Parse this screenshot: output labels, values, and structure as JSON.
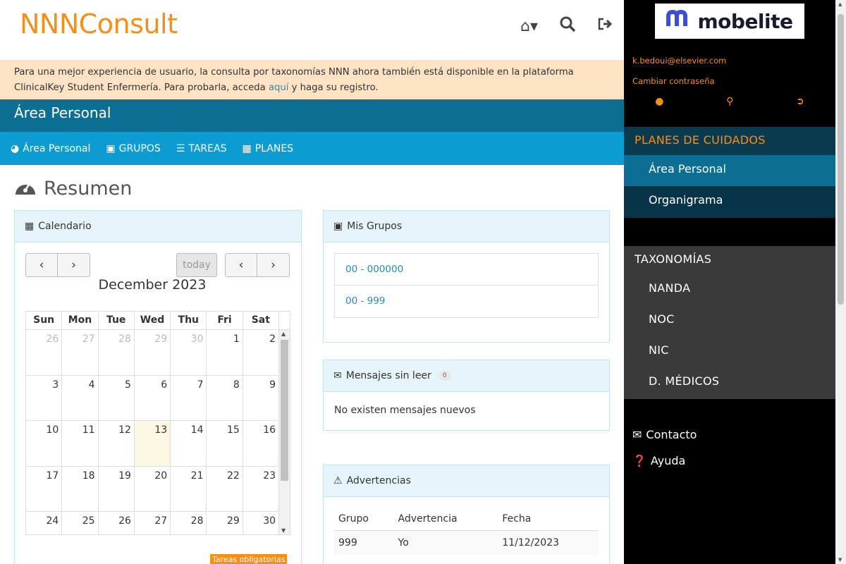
{
  "app": {
    "logo": "NNNConsult"
  },
  "banner": {
    "text_before": "Para una mejor experiencia de usuario, la consulta por taxonomías NNN ahora también está disponible en la plataforma ClinicalKey Student Enfermería. Para probarla, acceda ",
    "link": "aquí",
    "text_after": " y haga su registro."
  },
  "area_header": "Área Personal",
  "nav": [
    {
      "label": "Área Personal",
      "icon": "dashboard-icon"
    },
    {
      "label": "GRUPOS",
      "icon": "groups-icon"
    },
    {
      "label": "TAREAS",
      "icon": "tasks-icon"
    },
    {
      "label": "PLANES",
      "icon": "book-icon"
    }
  ],
  "page_title": "Resumen",
  "calendar": {
    "title": "Calendario",
    "month_label": "December 2023",
    "today_label": "today",
    "weekdays": [
      "Sun",
      "Mon",
      "Tue",
      "Wed",
      "Thu",
      "Fri",
      "Sat"
    ],
    "weeks": [
      [
        [
          "26",
          1
        ],
        [
          "27",
          1
        ],
        [
          "28",
          1
        ],
        [
          "29",
          1
        ],
        [
          "30",
          1
        ],
        [
          "1",
          0
        ],
        [
          "2",
          0
        ]
      ],
      [
        [
          "3",
          0
        ],
        [
          "4",
          0
        ],
        [
          "5",
          0
        ],
        [
          "6",
          0
        ],
        [
          "7",
          0
        ],
        [
          "8",
          0
        ],
        [
          "9",
          0
        ]
      ],
      [
        [
          "10",
          0
        ],
        [
          "11",
          0
        ],
        [
          "12",
          0
        ],
        [
          "13",
          2
        ],
        [
          "14",
          0
        ],
        [
          "15",
          0
        ],
        [
          "16",
          0
        ]
      ],
      [
        [
          "17",
          0
        ],
        [
          "18",
          0
        ],
        [
          "19",
          0
        ],
        [
          "20",
          0
        ],
        [
          "21",
          0
        ],
        [
          "22",
          0
        ],
        [
          "23",
          0
        ]
      ],
      [
        [
          "24",
          0
        ],
        [
          "25",
          0
        ],
        [
          "26",
          0
        ],
        [
          "27",
          0
        ],
        [
          "28",
          0
        ],
        [
          "29",
          0
        ],
        [
          "30",
          0
        ]
      ]
    ],
    "legend_label": "Tareas obligatorias"
  },
  "groups": {
    "title": "Mis Grupos",
    "items": [
      "00 - 000000",
      "00 - 999"
    ]
  },
  "messages": {
    "title": "Mensajes sin leer",
    "count": "0",
    "empty_text": "No existen mensajes nuevos"
  },
  "warnings": {
    "title": "Advertencias",
    "columns": [
      "Grupo",
      "Advertencia",
      "Fecha"
    ],
    "rows": [
      [
        "999",
        "Yo",
        "11/12/2023"
      ]
    ]
  },
  "sidebar": {
    "brand": "mobelite",
    "email": "k.bedoui@elsevier.com",
    "change_password": "Cambiar contraseña",
    "section1_title": "PLANES DE CUIDADOS",
    "section1_items": [
      "Área Personal",
      "Organigrama"
    ],
    "section2_title": "TAXONOMÍAS",
    "section2_items": [
      "NANDA",
      "NOC",
      "NIC",
      "D. MÉDICOS"
    ],
    "contact": "Contacto",
    "help": "Ayuda"
  },
  "colors": {
    "accent": "#f39019",
    "primary": "#0d9cd1",
    "dark_primary": "#0b6f93"
  }
}
